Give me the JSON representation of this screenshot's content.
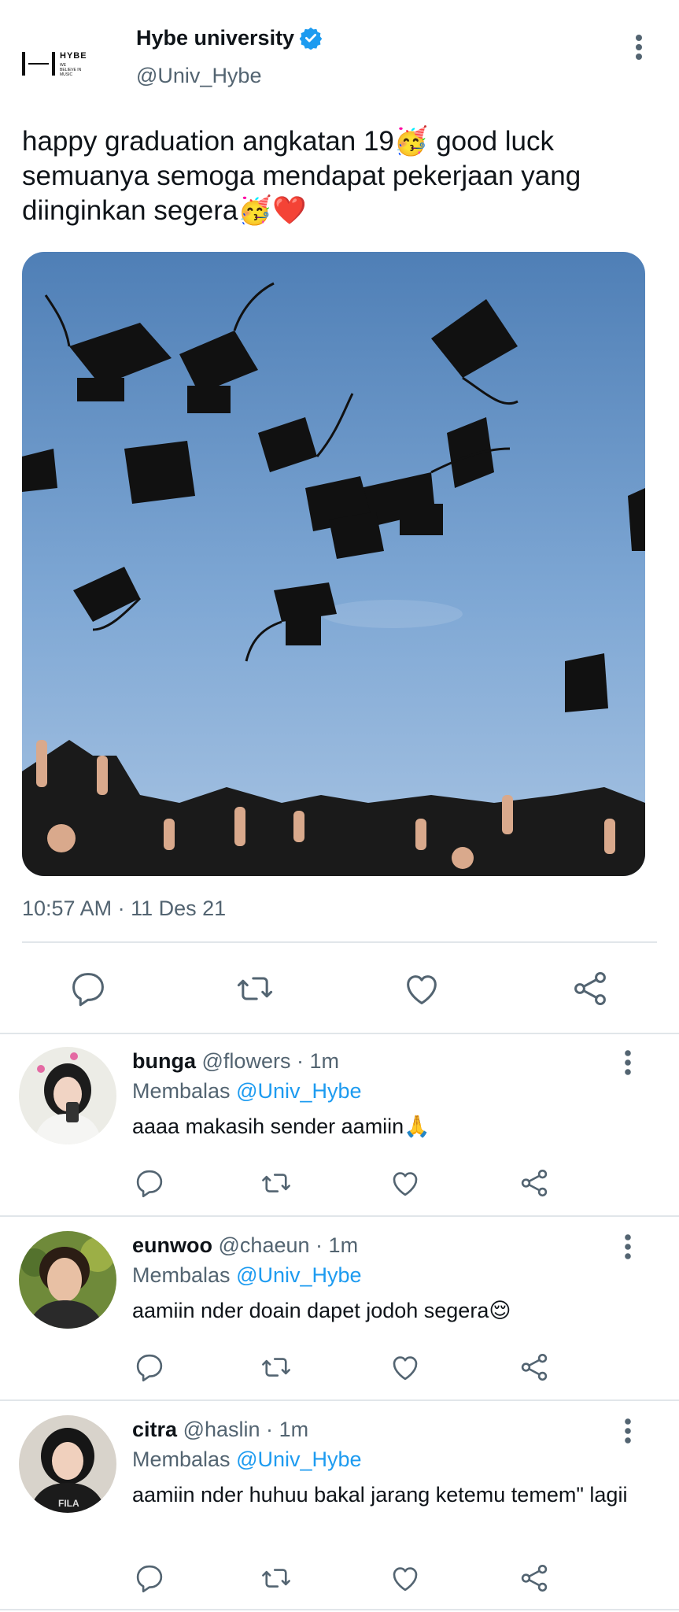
{
  "tweet": {
    "logo_text": "HYBE",
    "logo_tagline": "WE BELIEVE IN MUSIC",
    "author_name": "Hybe university",
    "author_handle": "@Univ_Hybe",
    "text_lines": [
      "happy graduation angkatan 19🥳 good luck",
      "semuanya semoga mendapat pekerjaan yang",
      "diinginkan segera🥳❤️"
    ],
    "media_description_icon": "graduation-caps-photo",
    "timestamp": "10:57 AM · 11 Des 21",
    "actions": [
      "reply-icon",
      "retweet-icon",
      "like-icon",
      "share-icon"
    ],
    "verified_color": "#1d9bf0"
  },
  "replies": [
    {
      "name": "bunga",
      "handle": "@flowers",
      "separator": "·",
      "time": "1m",
      "replying_prefix": "Membalas",
      "replying_to": "@Univ_Hybe",
      "text": "aaaa makasih sender aamiin🙏"
    },
    {
      "name": "eunwoo",
      "handle": "@chaeun",
      "separator": "·",
      "time": "1m",
      "replying_prefix": "Membalas",
      "replying_to": "@Univ_Hybe",
      "text": "aamiin nder doain dapet jodoh segera😌"
    },
    {
      "name": "citra",
      "handle": "@haslin",
      "separator": "·",
      "time": "1m",
      "replying_prefix": "Membalas",
      "replying_to": "@Univ_Hybe",
      "text": "aamiin nder huhuu bakal jarang ketemu temem\" lagii"
    }
  ],
  "colors": {
    "text_primary": "#0f1419",
    "text_secondary": "#536471",
    "link": "#1d9bf0",
    "divider": "#e1e6ea",
    "icon": "#536471"
  }
}
